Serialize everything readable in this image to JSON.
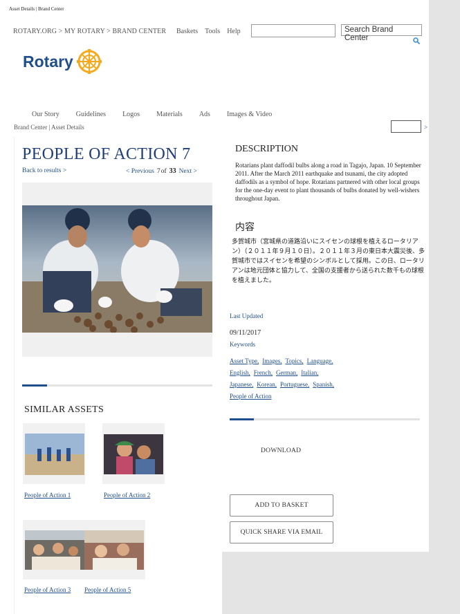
{
  "tab_title": "Asset Details | Brand Center",
  "header": {
    "breadcrumb": "ROTARY.ORG > MY ROTARY > BRAND CENTER",
    "nav": [
      "Baskets",
      "Tools",
      "Help"
    ],
    "search_placeholder": "Search Brand Center",
    "logo_text": "Rotary"
  },
  "main_nav": [
    "Our Story",
    "Guidelines",
    "Logos",
    "Materials",
    "Ads",
    "Images & Video"
  ],
  "breadcrumb2": "Brand Center | Asset Details",
  "small_arrow": ">",
  "asset": {
    "title": "PEOPLE OF ACTION 7",
    "back_link": "Back to results >",
    "prev": "< Previous",
    "current": "7",
    "of": "of",
    "total": "33",
    "next": "Next >"
  },
  "similar": {
    "heading": "SIMILAR ASSETS",
    "items": [
      "People of Action 1",
      "People of Action 2",
      "People of Action 3",
      "People of Action 5"
    ]
  },
  "description": {
    "heading": "DESCRIPTION",
    "text": "Rotarians plant daffodil bulbs along a road in Tagajo, Japan. 10 September 2011. After the March 2011 earthquake and tsunami, the city adopted daffodils as a symbol of hope. Rotarians partnered with other local groups for the one-day event to plant thousands of bulbs donated by well-wishers throughout Japan.",
    "jp_heading": "内容",
    "jp_text": "多賀城市（宮城県の道路沿いにスイセンの球根を植えるロータリアン）（２０１１年９月１０日）。２０１１年３月の東日本大震災後、多賀城市ではスイセンを希望のシンボルとして採用。この日、ロータリアンは地元団体と協力して、全国の支援者から送られた数千もの球根を植えました。"
  },
  "meta": {
    "updated_label": "Last Updated",
    "updated_value": "09/11/2017",
    "keywords_label": "Keywords",
    "keywords": [
      "Asset Type,",
      "Images,",
      "Topics,",
      "Language,",
      "English,",
      "French,",
      "German,",
      "Italian,",
      "Japanese,",
      "Korean,",
      "Portuguese,",
      "Spanish,",
      "People of Action"
    ]
  },
  "actions": {
    "download": "DOWNLOAD",
    "basket": "ADD TO BASKET",
    "share": "QUICK SHARE VIA EMAIL"
  },
  "colors": {
    "brand_blue": "#1f4e8c",
    "rotary_gold": "#f7a81b",
    "gutter_gray": "#e4e4e4"
  }
}
